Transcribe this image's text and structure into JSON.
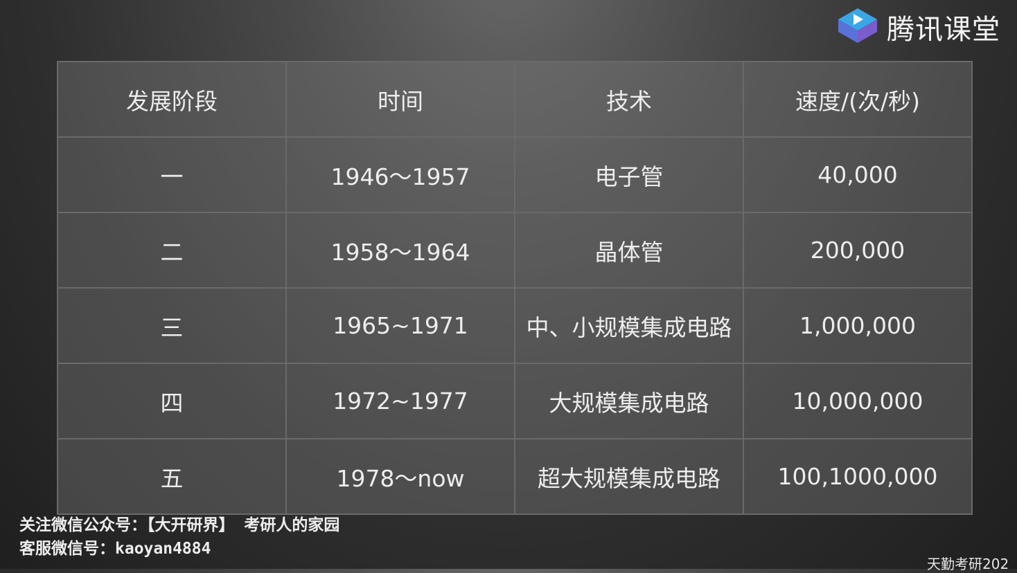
{
  "brand": {
    "name": "腾讯课堂",
    "accent_colors": [
      "#2f9bdc",
      "#5b6fd6",
      "#7a5bc9"
    ]
  },
  "table": {
    "headers": [
      "发展阶段",
      "时间",
      "技术",
      "速度/(次/秒)"
    ],
    "rows": [
      {
        "stage": "一",
        "time": "1946～1957",
        "tech": "电子管",
        "speed": "40,000"
      },
      {
        "stage": "二",
        "time": "1958～1964",
        "tech": "晶体管",
        "speed": "200,000"
      },
      {
        "stage": "三",
        "time": "1965~1971",
        "tech": "中、小规模集成电路",
        "speed": "1,000,000"
      },
      {
        "stage": "四",
        "time": "1972~1977",
        "tech": "大规模集成电路",
        "speed": "10,000,000"
      },
      {
        "stage": "五",
        "time": "1978～now",
        "tech": "超大规模集成电路",
        "speed": "100,1000,000"
      }
    ]
  },
  "watermark": {
    "line1": "关注微信公众号：【大开研界】 考研人的家园",
    "line2": "客服微信号：kaoyan4884",
    "corner": "天勤考研202"
  }
}
